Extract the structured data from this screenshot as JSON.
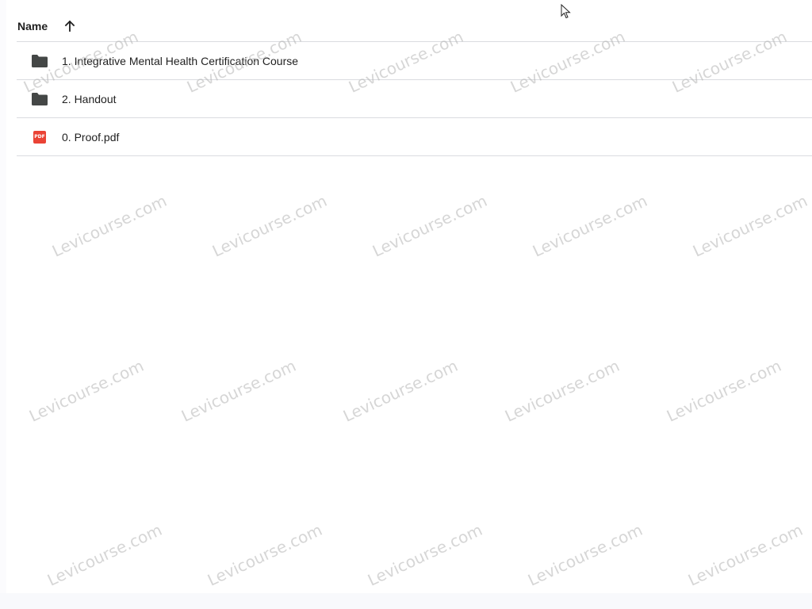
{
  "header": {
    "name_label": "Name",
    "sort_icon": "arrow-up-icon"
  },
  "rows": [
    {
      "icon": "folder-icon",
      "label": "1. Integrative Mental Health Certification Course"
    },
    {
      "icon": "folder-icon",
      "label": "2. Handout"
    },
    {
      "icon": "pdf-icon",
      "badge": "PDF",
      "label": "0. Proof.pdf"
    }
  ],
  "watermark": "Levicourse.com",
  "colors": {
    "folder": "#444746",
    "pdf": "#ea4335",
    "divider": "#dadce0"
  }
}
